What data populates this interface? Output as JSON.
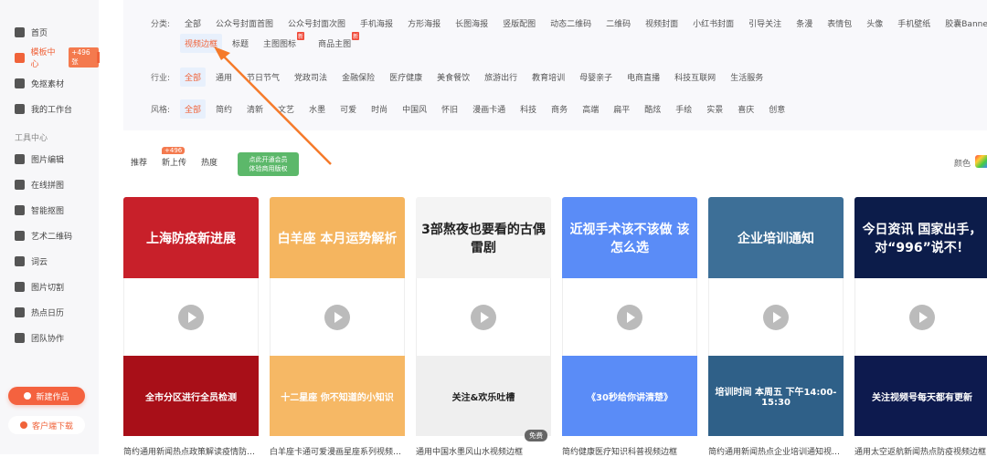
{
  "sidebar": {
    "items": [
      {
        "label": "首页",
        "icon": "home-icon"
      },
      {
        "label": "模板中心",
        "icon": "template-icon",
        "badge": "+496张",
        "active": true
      },
      {
        "label": "免抠素材",
        "icon": "material-icon"
      },
      {
        "label": "我的工作台",
        "icon": "desktop-icon"
      }
    ],
    "section": "工具中心",
    "tools": [
      {
        "label": "图片编辑"
      },
      {
        "label": "在线拼图"
      },
      {
        "label": "智能抠图"
      },
      {
        "label": "艺术二维码"
      },
      {
        "label": "词云"
      },
      {
        "label": "图片切割"
      },
      {
        "label": "热点日历"
      },
      {
        "label": "团队协作"
      }
    ],
    "new_button": "新建作品",
    "download_button": "客户端下载"
  },
  "filters": {
    "category": {
      "label": "分类:",
      "options": [
        "全部",
        "公众号封面首图",
        "公众号封面次图",
        "手机海报",
        "方形海报",
        "长图海报",
        "竖版配图",
        "动态二维码",
        "二维码",
        "视频封面",
        "小红书封面",
        "引导关注",
        "条漫",
        "表情包",
        "头像",
        "手机壁纸",
        "胶囊Banner"
      ],
      "options2": [
        "视频边框",
        "标题",
        "主图图标",
        "商品主图"
      ],
      "selected": "视频边框",
      "new_badge": "新"
    },
    "industry": {
      "label": "行业:",
      "options": [
        "全部",
        "通用",
        "节日节气",
        "党政司法",
        "金融保险",
        "医疗健康",
        "美食餐饮",
        "旅游出行",
        "教育培训",
        "母婴亲子",
        "电商直播",
        "科技互联网",
        "生活服务"
      ],
      "selected": "全部"
    },
    "style": {
      "label": "风格:",
      "options": [
        "全部",
        "简约",
        "清新",
        "文艺",
        "水墨",
        "可爱",
        "时尚",
        "中国风",
        "怀旧",
        "漫画卡通",
        "科技",
        "商务",
        "高端",
        "扁平",
        "酷炫",
        "手绘",
        "实景",
        "喜庆",
        "创意"
      ],
      "selected": "全部"
    }
  },
  "tabs": [
    {
      "label": "推荐"
    },
    {
      "label": "新上传",
      "badge": "+496"
    },
    {
      "label": "热度"
    }
  ],
  "promo": {
    "line1": "点此开通会员",
    "line2": "体验商用版权"
  },
  "color_label": "颜色",
  "cards": [
    {
      "top": "上海防疫新进展",
      "bottom": "全市分区进行全员检测",
      "title": "简约通用新闻热点政策解读疫情防控视...",
      "top_bg": "#c8202a",
      "bot_bg": "#a80f18"
    },
    {
      "top": "白羊座 本月运势解析",
      "bottom": "十二星座 你不知道的小知识",
      "title": "白羊座卡通可爱漫画星座系列视频边框",
      "top_bg": "#f5b55f",
      "bot_bg": "#f6b865"
    },
    {
      "top": "3部熬夜也要看的古偶雷剧",
      "bottom": "关注&欢乐吐槽",
      "title": "通用中国水墨风山水视频边框",
      "top_bg": "#f4f4f4",
      "bot_bg": "#efefef",
      "dark": true,
      "free": "免费"
    },
    {
      "top": "近视手术该不该做 该怎么选",
      "bottom": "《30秒给你讲清楚》",
      "title": "简约健康医疗知识科普视频边框",
      "top_bg": "#5a8cf7",
      "bot_bg": "#5a8cf7"
    },
    {
      "top": "企业培训通知",
      "bottom": "培训时间 本周五 下午14:00-15:30",
      "title": "简约通用新闻热点企业培训通知视频边框",
      "top_bg": "#3d6f97",
      "bot_bg": "#2f6088"
    },
    {
      "top": "今日资讯 国家出手，对“996”说不！",
      "bottom": "关注视频号每天都有更新",
      "title": "通用太空返航新闻热点防疫视频边框",
      "top_bg": "#0c1c4a",
      "bot_bg": "#0d1a4e"
    }
  ]
}
